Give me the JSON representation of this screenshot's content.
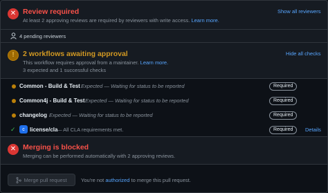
{
  "review": {
    "title": "Review required",
    "description": "At least 2 approving reviews are required by reviewers with write access.",
    "learn_more": "Learn more.",
    "action": "Show all reviewers",
    "pending": "4 pending reviewers"
  },
  "workflows": {
    "title": "2 workflows awaiting approval",
    "description": "This workflow requires approval from a maintainer.",
    "learn_more": "Learn more.",
    "summary": "3 expected and 1 successful checks",
    "action": "Hide all checks"
  },
  "checks": [
    {
      "name": "Common - Build & Test",
      "status": "Expected — Waiting for status to be reported",
      "badge": "Required"
    },
    {
      "name": "Common4j - Build & Test",
      "status": "Expected — Waiting for status to be reported",
      "badge": "Required"
    },
    {
      "name": "changelog",
      "status": "Expected — Waiting for status to be reported",
      "badge": "Required"
    },
    {
      "name": "license/cla",
      "status": "— All CLA requirements met.",
      "badge": "Required",
      "details": "Details"
    }
  ],
  "merge": {
    "title": "Merging is blocked",
    "description": "Merging can be performed automatically with 2 approving reviews.",
    "button": "Merge pull request",
    "footer_prefix": "You're not",
    "footer_link": "authorized",
    "footer_suffix": "to merge this pull request."
  },
  "colors": {
    "error": "#f85149",
    "warning": "#d29922",
    "success": "#3fb950",
    "link": "#58a6ff"
  },
  "icons": {
    "review": "x-circle-icon",
    "pending": "person-icon",
    "workflows": "alert-icon",
    "merge": "x-circle-icon",
    "merge_button": "merge-icon"
  }
}
